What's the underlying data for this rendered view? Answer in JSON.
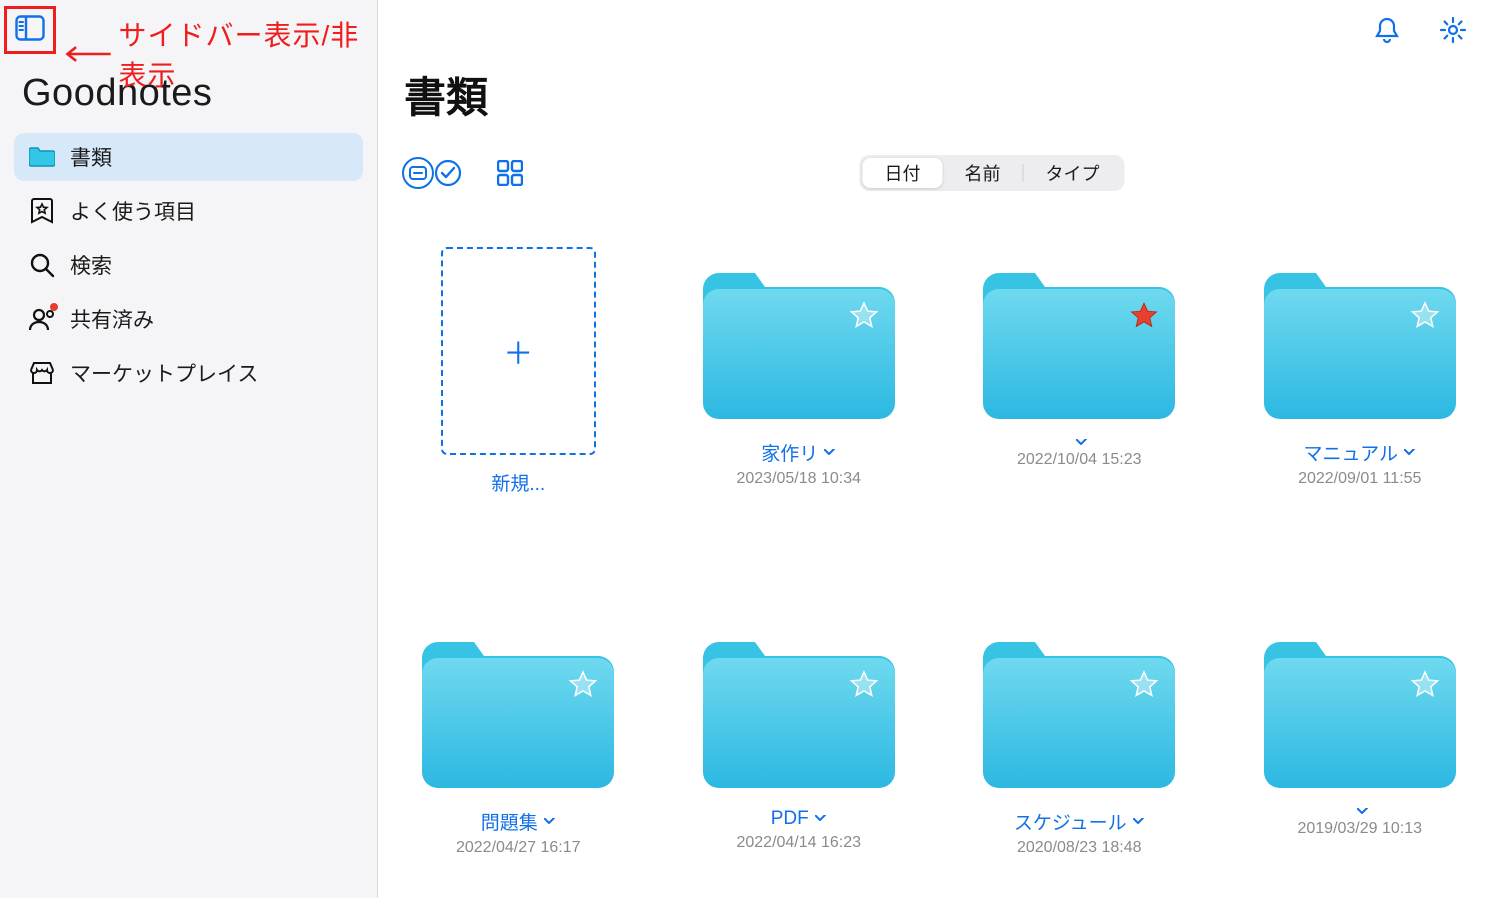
{
  "annotation": {
    "text": "サイドバー表示/非表示"
  },
  "brand": "Goodnotes",
  "sidebar": {
    "items": [
      {
        "label": "書類",
        "icon": "folder",
        "active": true
      },
      {
        "label": "よく使う項目",
        "icon": "bookmark-star"
      },
      {
        "label": "検索",
        "icon": "search"
      },
      {
        "label": "共有済み",
        "icon": "person-shared",
        "badge": true
      },
      {
        "label": "マーケットプレイス",
        "icon": "storefront"
      }
    ]
  },
  "page": {
    "title": "書類"
  },
  "sort": {
    "options": [
      "日付",
      "名前",
      "タイプ"
    ],
    "active_index": 0
  },
  "grid": {
    "new_label": "新規...",
    "items": [
      {
        "name": "家作リ",
        "date": "2023/05/18 10:34",
        "starred": false
      },
      {
        "name": "",
        "date": "2022/10/04 15:23",
        "starred": true
      },
      {
        "name": "マニュアル",
        "date": "2022/09/01 11:55",
        "starred": false
      },
      {
        "name": "問題集",
        "date": "2022/04/27 16:17",
        "starred": false
      },
      {
        "name": "PDF",
        "date": "2022/04/14 16:23",
        "starred": false
      },
      {
        "name": "スケジュール",
        "date": "2020/08/23 18:48",
        "starred": false
      },
      {
        "name": "",
        "date": "2019/03/29 10:13",
        "starred": false
      }
    ]
  },
  "colors": {
    "accent": "#1070e8",
    "folder_light": "#63d3ea",
    "folder_dark": "#2bb7e0",
    "annotation": "#ef1e1e"
  }
}
